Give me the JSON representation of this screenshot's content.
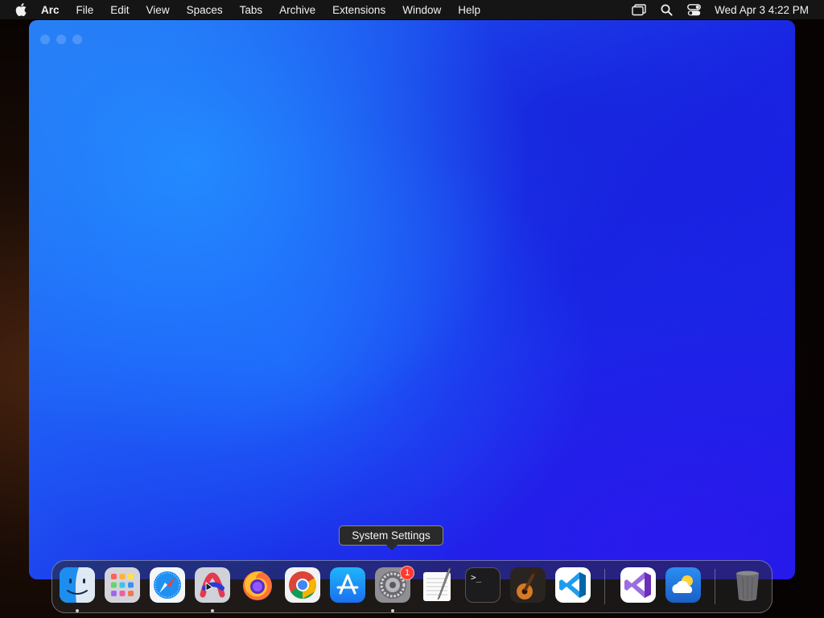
{
  "menubar": {
    "apple_icon": "apple-icon",
    "app_name": "Arc",
    "menus": [
      "File",
      "Edit",
      "View",
      "Spaces",
      "Tabs",
      "Archive",
      "Extensions",
      "Window",
      "Help"
    ],
    "status_icons": [
      "screen-mirroring-icon",
      "search-icon",
      "control-center-icon"
    ],
    "clock": "Wed Apr 3  4:22 PM"
  },
  "tooltip": {
    "text": "System Settings"
  },
  "dock": {
    "apps": [
      {
        "name": "Finder",
        "icon": "finder-icon",
        "running": true
      },
      {
        "name": "Launchpad",
        "icon": "launchpad-icon",
        "running": false
      },
      {
        "name": "Safari",
        "icon": "safari-icon",
        "running": false
      },
      {
        "name": "Arc",
        "icon": "arc-icon",
        "running": true
      },
      {
        "name": "Firefox",
        "icon": "firefox-icon",
        "running": false
      },
      {
        "name": "Chrome",
        "icon": "chrome-icon",
        "running": false
      },
      {
        "name": "App Store",
        "icon": "app-store-icon",
        "running": false
      },
      {
        "name": "System Settings",
        "icon": "system-settings-icon",
        "running": true,
        "badge": "1"
      },
      {
        "name": "TextEdit",
        "icon": "textedit-icon",
        "running": false
      },
      {
        "name": "Terminal",
        "icon": "terminal-icon",
        "running": false
      },
      {
        "name": "GarageBand",
        "icon": "garageband-icon",
        "running": false
      },
      {
        "name": "Visual Studio Code",
        "icon": "vscode-icon",
        "running": false
      },
      {
        "name": "Visual Studio",
        "icon": "visual-studio-icon",
        "running": false
      },
      {
        "name": "Weather",
        "icon": "weather-icon",
        "running": false
      },
      {
        "name": "Trash",
        "icon": "trash-icon",
        "running": false
      }
    ],
    "terminal_prompt": ">_"
  },
  "colors": {
    "menubar_bg": "#151515",
    "window_blue": "#1f5bf5",
    "badge_red": "#ff3b30"
  }
}
